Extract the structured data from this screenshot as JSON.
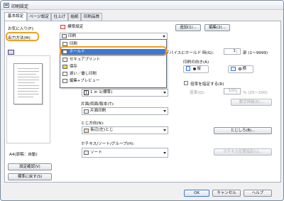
{
  "window": {
    "title": "印刷設定"
  },
  "tabs": [
    "基本設定",
    "ページ設定",
    "仕上げ",
    "給紙",
    "印刷品質"
  ],
  "favorites": {
    "label": "お気に入り(F):",
    "value": "標準設定",
    "add_button": "追加(1)...",
    "edit_button": "編集(2)..."
  },
  "output_method": {
    "label": "出力方法(M):",
    "value": "印刷"
  },
  "dropdown": {
    "items": [
      "印刷",
      "ホールド",
      "セキュアプリント",
      "保存",
      "遅い／優し印刷",
      "編集+プレビュー"
    ],
    "selected_index": 1
  },
  "preview": {
    "caption": "A4(原稿：自動)",
    "settings_button": "設定確認(V)",
    "defaults_button": "標準に戻す(S)"
  },
  "orig_size": {
    "label": "デバイスにホールド 時(G):",
    "copies": "1",
    "copies_range": "部 (1〜9999)"
  },
  "orientation": {
    "label": "印刷の向き(A)",
    "portrait": "縦",
    "landscape": "横"
  },
  "pages_per_sheet": {
    "value": "1 in 1(標準)"
  },
  "scale": {
    "label": "倍率を指定する(R)",
    "field_label": "倍率(Q):",
    "value": "100",
    "range": "% (25〜200)"
  },
  "detail_button": "数字詳細(E)...",
  "duplex": {
    "label": "片面/両面/製本(T):",
    "value": "片面印刷"
  },
  "binding": {
    "label": "とじ方向(N):",
    "value": "長辺(左)とじ",
    "button": "とじしろ(B)..."
  },
  "staple": {
    "label": "ホチキス/ソート/グループ(H):",
    "value": "ソート",
    "button": "ホチキス位置指定(L)..."
  },
  "footer": {
    "ok": "OK",
    "cancel": "キャンセル",
    "help": "ヘルプ"
  },
  "colors": {
    "accent": "#3b78d8",
    "highlight": "#f0a020"
  }
}
